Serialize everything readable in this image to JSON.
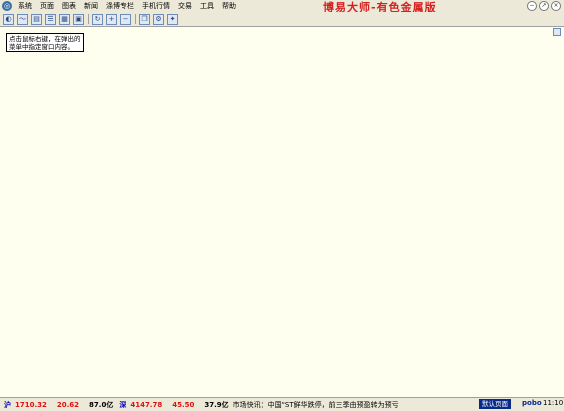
{
  "menubar": {
    "items": [
      "系统",
      "页面",
      "图表",
      "新闻",
      "涤博专栏",
      "手机行情",
      "交易",
      "工具",
      "帮助"
    ]
  },
  "app_title": "博易大师-有色金属版",
  "window_buttons": [
    "−",
    "↗",
    "×"
  ],
  "toolbar": {
    "icons": [
      "chart-icon",
      "line-chart-icon",
      "table-icon",
      "list-icon",
      "grid-icon",
      "window-icon",
      "refresh-icon",
      "zoom-in-icon",
      "zoom-out-icon",
      "copy-icon",
      "settings-icon",
      "magic-icon"
    ]
  },
  "tooltip": {
    "line1": "点击鼠标右键，在弹出的",
    "line2": "菜单中指定窗口内容。"
  },
  "statusbar": {
    "index1_value": "1710.32",
    "index1_change": "20.62",
    "index1_volume": "87.0亿",
    "index2_label": "深",
    "index2_value": "4147.78",
    "index2_change": "45.50",
    "index2_volume": "37.9亿",
    "ticker": "市场快讯：中国\"ST鲜华跌停，前三季由预盈转为预亏",
    "default_page": "默认页面",
    "logo": "pobo",
    "time": "11:10"
  },
  "colors": {
    "title": "#d42020",
    "up": "#e01010",
    "background": "#fffff0"
  }
}
